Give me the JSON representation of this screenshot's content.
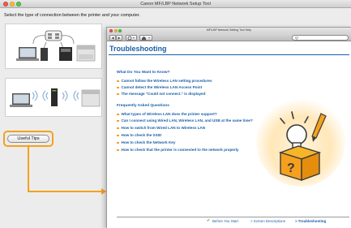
{
  "setup_window": {
    "title": "Canon MF/LBP Network Setup Tool",
    "instruction": "Select the type of connection between the printer and your computer.",
    "useful_tips_button": "Useful Tips"
  },
  "help_window": {
    "title": "MF/LBP Network Setting Tool Help",
    "back_label": "◀",
    "forward_label": "▶",
    "search_glyph": "Q-",
    "page_title": "Troubleshooting",
    "section_know": "What Do You Want to Know?",
    "know_links": [
      "Cannot follow the Wireless LAN setting procedures",
      "Cannot detect the Wireless LAN Access Point",
      "The message \"Could not connect.\" is displayed"
    ],
    "section_faq": "Frequently Asked Questions",
    "faq_links": [
      "What types of Wireless LAN does the printer support?",
      "Can I connect using Wired LAN, Wireless LAN, and USB at the same time?",
      "How to switch from Wired LAN to Wireless LAN",
      "How to check the SSID",
      "How to check the Network Key",
      "How to check that the printer is connected to the network properly"
    ],
    "footer": {
      "before_you_start": "Before You Start",
      "screen_descriptions": "> Screen Descriptions",
      "troubleshooting": "> Troubleshooting"
    }
  },
  "colors": {
    "link_blue": "#1a5ea8",
    "highlight_orange": "#f5a11e"
  }
}
